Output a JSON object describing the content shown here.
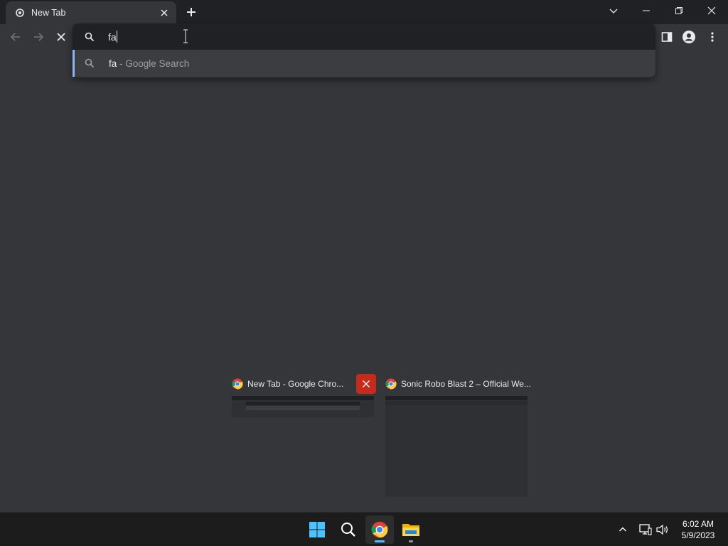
{
  "browser": {
    "tab": {
      "title": "New Tab"
    },
    "window_controls": [
      "chevron-down",
      "minimize",
      "restore",
      "close"
    ]
  },
  "omnibox": {
    "value": "fa",
    "suggestion": {
      "query": "fa",
      "suffix": " - Google Search"
    }
  },
  "task_switcher": {
    "windows": [
      {
        "title": "New Tab - Google Chro..."
      },
      {
        "title": "Sonic Robo Blast 2 – Official We..."
      }
    ]
  },
  "taskbar": {
    "apps": [
      "windows-start",
      "search",
      "chrome",
      "file-explorer"
    ],
    "clock": {
      "time": "6:02 AM",
      "date": "5/9/2023"
    }
  },
  "colors": {
    "accent": "#8ab4f8",
    "close_red": "#c42b1c",
    "background": "#35363a"
  }
}
